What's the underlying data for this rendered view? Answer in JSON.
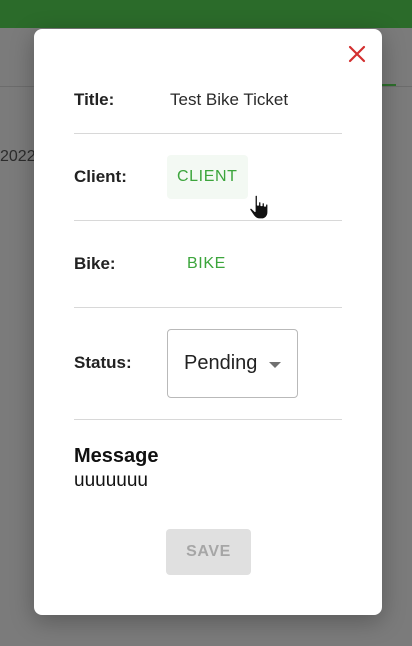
{
  "background": {
    "partial_text": "2022"
  },
  "dialog": {
    "close_icon": "close-icon",
    "title_label": "Title:",
    "title_value": "Test Bike Ticket",
    "client_label": "Client:",
    "client_button": "CLIENT",
    "bike_label": "Bike:",
    "bike_button": "BIKE",
    "status_label": "Status:",
    "status_value": "Pending",
    "message_heading": "Message",
    "message_text": "uuuuuuu",
    "save_button": "SAVE",
    "save_disabled": true
  },
  "colors": {
    "app_bar": "#2b6b2a",
    "accent_green": "#3ca53c",
    "close_red": "#d32f2f",
    "overlay": "#7b7b7b"
  }
}
